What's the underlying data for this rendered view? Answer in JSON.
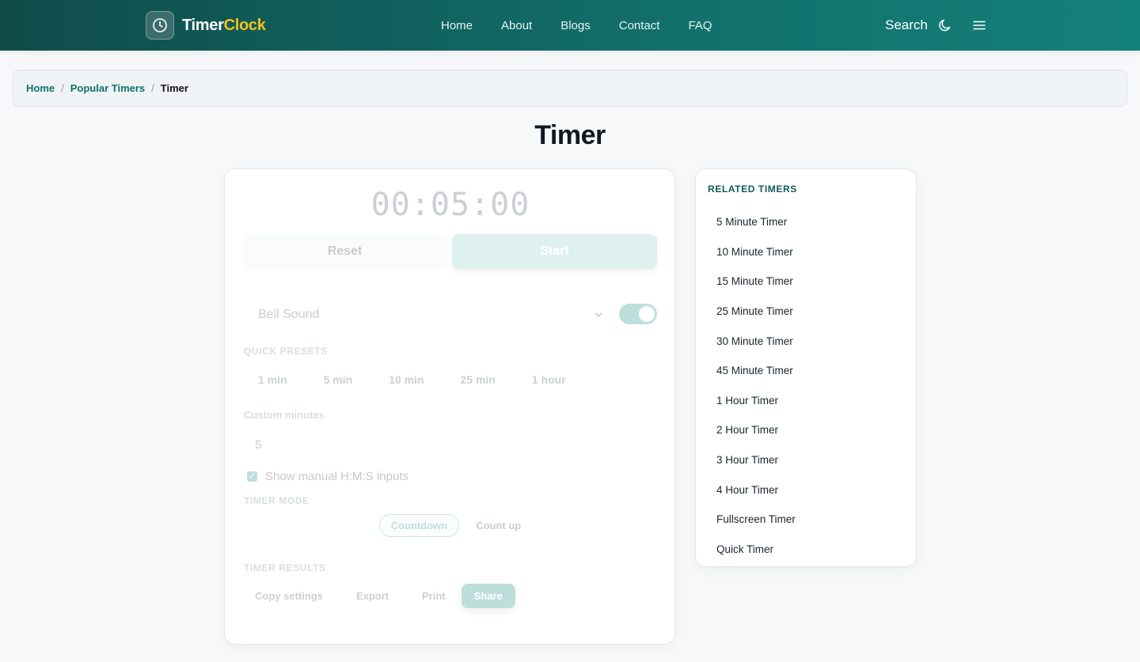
{
  "header": {
    "brand_part1": "Timer",
    "brand_part2": "Clock",
    "nav": [
      "Home",
      "About",
      "Blogs",
      "Contact",
      "FAQ"
    ],
    "search_label": "Search",
    "colors": {
      "brand_accent": "#f5c21b",
      "header_bg": "#12706c"
    }
  },
  "breadcrumb": {
    "items": [
      "Home",
      "Popular Timers"
    ],
    "current": "Timer"
  },
  "page": {
    "title": "Timer"
  },
  "timer": {
    "display": "00:05:00",
    "reset_label": "Reset",
    "start_label": "Start",
    "sound_value": "Bell Sound",
    "sound_enabled": true,
    "quick_presets_label": "QUICK PRESETS",
    "presets": [
      "1 min",
      "5 min",
      "10 min",
      "25 min",
      "1 hour"
    ],
    "custom_minutes_label": "Custom minutes",
    "custom_minutes_value": "5",
    "manual_inputs_label": "Show manual H:M:S inputs",
    "manual_inputs_checked": true,
    "mode_label": "TIMER MODE",
    "modes": [
      "Countdown",
      "Count up"
    ],
    "active_mode": "Countdown",
    "results_label": "TIMER RESULTS",
    "results_actions": [
      "Copy settings",
      "Export",
      "Print",
      "Share"
    ]
  },
  "related": {
    "title": "RELATED TIMERS",
    "items": [
      "5 Minute Timer",
      "10 Minute Timer",
      "15 Minute Timer",
      "25 Minute Timer",
      "30 Minute Timer",
      "45 Minute Timer",
      "1 Hour Timer",
      "2 Hour Timer",
      "3 Hour Timer",
      "4 Hour Timer",
      "Fullscreen Timer",
      "Quick Timer"
    ]
  },
  "icons": {
    "logo": "clock-icon",
    "theme": "moon-icon",
    "menu": "hamburger-menu-icon",
    "select": "chevron-down-icon",
    "checkbox": "checkmark-icon"
  }
}
